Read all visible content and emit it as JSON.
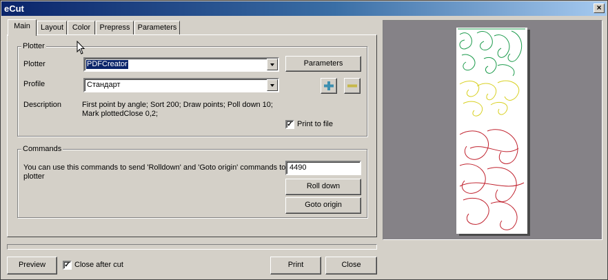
{
  "window": {
    "title": "eCut"
  },
  "tabs": [
    {
      "label": "Main"
    },
    {
      "label": "Layout"
    },
    {
      "label": "Color"
    },
    {
      "label": "Prepress"
    },
    {
      "label": "Parameters"
    }
  ],
  "plotter_group": {
    "title": "Plotter",
    "plotter_label": "Plotter",
    "plotter_value": "PDFCreator",
    "parameters_button": "Parameters",
    "profile_label": "Profile",
    "profile_value": "Стандарт",
    "description_label": "Description",
    "description_line1": "First point by angle; Sort 200; Draw points; Poll down 10;",
    "description_line2": "Mark plottedClose 0,2;",
    "print_to_file_label": "Print to file",
    "print_to_file_checked": true
  },
  "commands_group": {
    "title": "Commands",
    "info_line1": "You can use this commands to send 'Rolldown' and 'Goto origin' commands to",
    "info_line2": "plotter",
    "distance_value": "4490",
    "roll_down_button": "Roll down",
    "goto_origin_button": "Goto origin"
  },
  "footer": {
    "preview_button": "Preview",
    "close_after_cut_label": "Close after cut",
    "close_after_cut_checked": true,
    "print_button": "Print",
    "close_button": "Close"
  },
  "preview": {
    "layer_colors": [
      "#1a9a4a",
      "#d8d020",
      "#c0202c"
    ]
  }
}
